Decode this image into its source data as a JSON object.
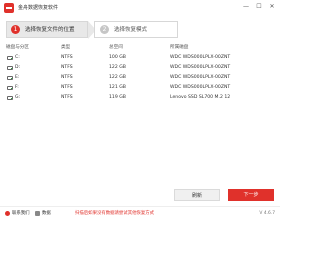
{
  "app": {
    "title": "金舟数据恢复软件"
  },
  "window_controls": {
    "minimize": "—",
    "maximize": "☐",
    "close": "✕"
  },
  "steps": [
    {
      "number": "1",
      "label": "选择恢复文件的位置"
    },
    {
      "number": "2",
      "label": "选择恢复模式"
    }
  ],
  "table": {
    "headers": [
      "磁盘与分区",
      "类型",
      "总空间",
      "所属磁盘"
    ],
    "rows": [
      {
        "drive": "C:",
        "type": "NTFS",
        "size": "100 GB",
        "disk": "WDC WDS000LPLX-00ZNT"
      },
      {
        "drive": "D:",
        "type": "NTFS",
        "size": "122 GB",
        "disk": "WDC WDS000LPLX-00ZNT"
      },
      {
        "drive": "E:",
        "type": "NTFS",
        "size": "122 GB",
        "disk": "WDC WDS000LPLX-00ZNT"
      },
      {
        "drive": "F:",
        "type": "NTFS",
        "size": "121 GB",
        "disk": "WDC WDS000LPLX-00ZNT"
      },
      {
        "drive": "G:",
        "type": "NTFS",
        "size": "119 GB",
        "disk": "Lenovo SSD SL700 M.2 12"
      }
    ]
  },
  "buttons": {
    "refresh": "刷新",
    "next": "下一步"
  },
  "footer": {
    "item1": "联系我们",
    "item2": "数据",
    "notice": "扫描后如果没有数据请尝试其他恢复方式",
    "version": "V 4.6.7"
  },
  "colors": {
    "accent": "#e0312b"
  }
}
